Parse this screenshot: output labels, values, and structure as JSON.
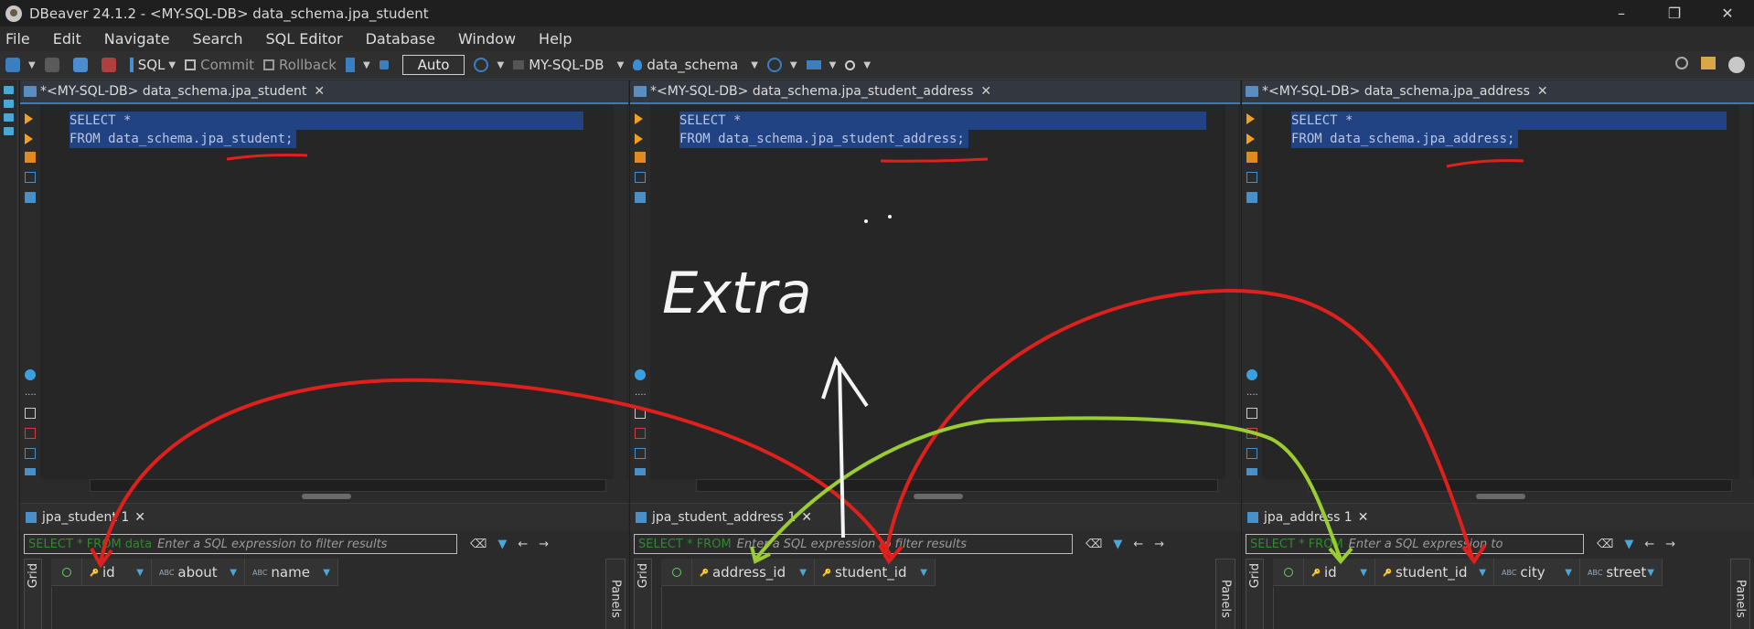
{
  "window": {
    "title": "DBeaver 24.1.2 - <MY-SQL-DB> data_schema.jpa_student",
    "minimize": "–",
    "maximize": "❐",
    "close": "✕"
  },
  "menu": [
    "File",
    "Edit",
    "Navigate",
    "Search",
    "SQL Editor",
    "Database",
    "Window",
    "Help"
  ],
  "toolbar": {
    "sql": "SQL",
    "commit": "Commit",
    "rollback": "Rollback",
    "auto": "Auto",
    "connection": "MY-SQL-DB",
    "schema": "data_schema"
  },
  "panes": [
    {
      "tab": "*<MY-SQL-DB> data_schema.jpa_student",
      "line1": "SELECT *",
      "line2": "FROM data_schema.jpa_student;",
      "result_tab": "jpa_student 1",
      "filter_prefix": "SELECT * FROM data",
      "filter_placeholder": "Enter a SQL expression to filter results",
      "grid_label": "Grid",
      "panels_label": "Panels",
      "columns": [
        "id",
        "about",
        "name"
      ]
    },
    {
      "tab": "*<MY-SQL-DB> data_schema.jpa_student_address",
      "line1": "SELECT *",
      "line2": "FROM data_schema.jpa_student_address;",
      "result_tab": "jpa_student_address 1",
      "filter_prefix": "SELECT * FROM",
      "filter_placeholder": "Enter a SQL expression to filter results",
      "grid_label": "Grid",
      "panels_label": "Panels",
      "columns": [
        "address_id",
        "student_id"
      ]
    },
    {
      "tab": "*<MY-SQL-DB> data_schema.jpa_address",
      "line1": "SELECT *",
      "line2": "FROM data_schema.jpa_address;",
      "result_tab": "jpa_address 1",
      "filter_prefix": "SELECT * FROM",
      "filter_placeholder": "Enter a SQL expression to",
      "grid_label": "Grid",
      "panels_label": "Panels",
      "columns": [
        "id",
        "student_id",
        "city",
        "street"
      ]
    }
  ],
  "annotation": {
    "handwritten_text": "Extra",
    "colors": {
      "red": "#e0201c",
      "green": "#9acd32",
      "white": "#f4f4f4"
    }
  }
}
